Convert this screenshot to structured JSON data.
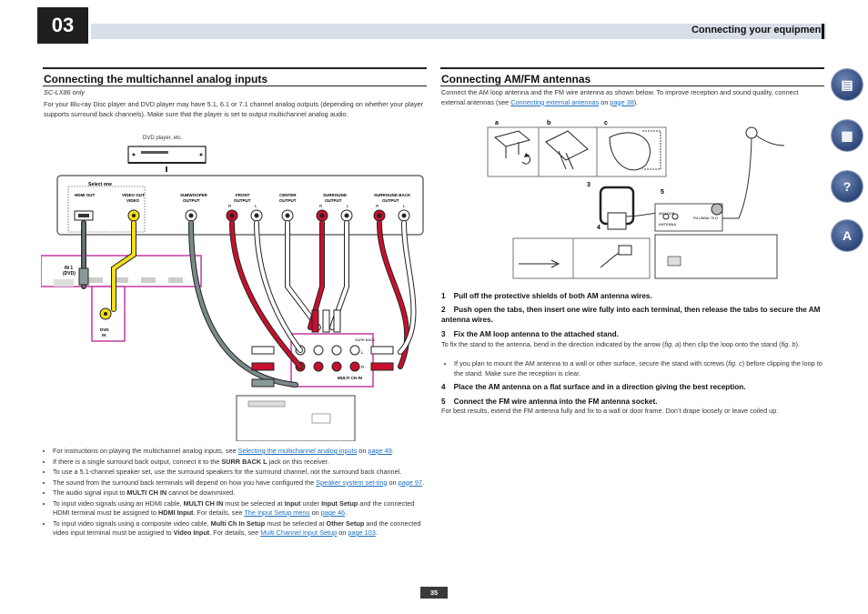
{
  "header": {
    "chapter": "03",
    "title": "Connecting your equipment"
  },
  "left": {
    "heading": "Connecting the multichannel analog inputs",
    "model_note": "SC-LX86 only",
    "intro": "For your Blu-ray Disc player and DVD player may have 5.1, 6.1 or 7.1 channel analog outputs (depending on whether your player supports surround back channels). Make sure that the player is set to output multichannel analog audio.",
    "diagram": {
      "dvd_label": "DVD player, etc.",
      "select_one": "Select one",
      "hdmi_out": "HDMI OUT",
      "video_out": "VIDEO OUT",
      "video": "VIDEO",
      "subwoofer": "SUBWOOFER",
      "front": "FRONT",
      "center": "CENTER",
      "surround": "SURROUND",
      "surround_back": "SURROUND BACK",
      "output": "OUTPUT",
      "r": "R",
      "l": "L",
      "in1": "IN 1",
      "dvd": "(DVD)",
      "dvd_in": "DVD",
      "in": "IN",
      "surr_back": "SURR BACK",
      "multi_ch_in": "MULTI CH IN"
    },
    "bullets": [
      {
        "pre": "For instructions on playing the multichannel analog inputs, see ",
        "link1": "Selecting the multichannel analog inputs",
        "mid": " on ",
        "link2": "page 49",
        "post": "."
      },
      {
        "pre": "If there is a single surround back output, connect it to the ",
        "bold": "SURR BACK L",
        "post": " jack on this receiver."
      },
      {
        "text": "To use a 5.1-channel speaker set, use the surround speakers for the surround channel, not the surround back channel."
      },
      {
        "pre": "The sound from the surround back terminals will depend on how you have configured the ",
        "link1": "Speaker system set-ting",
        "mid": " on ",
        "link2": "page 97",
        "post": "."
      },
      {
        "pre": "The audio signal input to ",
        "bold": "MULTI CH IN",
        "post": " cannot be downmixed."
      },
      {
        "t1": "To input video signals using an HDMI cable, ",
        "b1": "MULTI CH IN",
        "t2": " must be selected at ",
        "b2": "Input",
        "t3": " under ",
        "b3": "Input Setup",
        "t4": " and the connected HDMI terminal must be assigned to ",
        "b4": "HDMI Input",
        "t5": ". For details, see ",
        "link1": "The Input Setup menu",
        "t6": " on ",
        "link2": "page 46",
        "t7": "."
      },
      {
        "t1": "To input video signals using a composite video cable, ",
        "b1": "Multi Ch In Setup",
        "t2": " must be selected at ",
        "b2": "Other Setup",
        "t3": " and the connected video input terminal must be assigned to ",
        "b3": "Video Input",
        "t4": ". For details, see ",
        "link1": "Multi Channel Input Setup",
        "t5": " on ",
        "link2": "page 103",
        "t6": "."
      }
    ]
  },
  "right": {
    "heading": "Connecting AM/FM antennas",
    "intro_pre": "Connect the AM loop antenna and the FM wire antenna as shown below. To improve reception and sound quality, connect external antennas (see ",
    "intro_link1": "Connecting external antennas",
    "intro_mid": " on ",
    "intro_link2": "page 38",
    "intro_post": ").",
    "diagram": {
      "a": "a",
      "b": "b",
      "c": "c",
      "n1": "1",
      "n2": "2",
      "n3": "3",
      "n4": "4",
      "n5": "5",
      "am_loop": "AM LOOP",
      "antenna": "ANTENNA",
      "fm": "FM UNBAL 75 Ω"
    },
    "steps": [
      {
        "num": "1",
        "text": "Pull off the protective shields of both AM antenna wires."
      },
      {
        "num": "2",
        "text": "Push open the tabs, then insert one wire fully into each terminal, then release the tabs to secure the AM antenna wires."
      },
      {
        "num": "3",
        "text": "Fix the AM loop antenna to the attached stand."
      }
    ],
    "step3_desc_pre": "To fix the stand to the antenna, bend in the direction indicated by the arrow (",
    "step3_desc_fig": "fig. a",
    "step3_desc_mid": ") then clip the loop onto the stand (",
    "step3_desc_fig2": "fig. b",
    "step3_desc_post": ").",
    "step3_bullet_pre": "If you plan to mount the AM antenna to a wall or other surface, secure the stand with screws (",
    "step3_bullet_fig": "fig. c",
    "step3_bullet_post": ") before clipping the loop to the stand. Make sure the reception is clear.",
    "step4": {
      "num": "4",
      "text": "Place the AM antenna on a flat surface and in a direction giving the best reception."
    },
    "step5": {
      "num": "5",
      "text": "Connect the FM wire antenna into the FM antenna socket."
    },
    "step5_desc": "For best results, extend the FM antenna fully and fix to a wall or door frame. Don’t drape loosely or leave coiled up."
  },
  "page_number": "35",
  "side_icons": [
    "book-icon",
    "remote-icon",
    "settings-question-icon",
    "az-icon"
  ],
  "colors": {
    "link": "#1a6fc1",
    "header_bar": "#d7dee7",
    "cable_red": "#c8102e",
    "cable_yellow": "#f2e01a",
    "highlight_border": "#c33aa0"
  }
}
